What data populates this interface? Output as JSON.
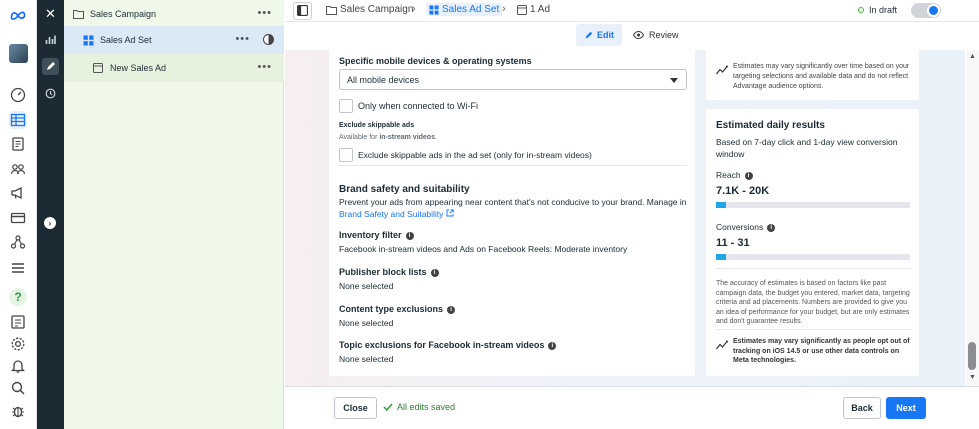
{
  "rail": {
    "icons": [
      "meta-logo-icon",
      "avatar",
      "dashboard-icon",
      "campaigns-table-icon",
      "pages-icon",
      "audiences-icon",
      "megaphone-icon",
      "billing-icon",
      "events-icon",
      "menu-icon",
      "help-icon",
      "reports-icon",
      "settings-icon",
      "notifications-icon",
      "search-icon",
      "bug-icon"
    ]
  },
  "tree": {
    "campaign_label": "Sales Campaign",
    "adset_label": "Sales Ad Set",
    "ad_label": "New Sales Ad"
  },
  "topbar": {
    "crumb_campaign": "Sales Campaign",
    "crumb_adset": "Sales Ad Set",
    "crumb_ad": "1 Ad",
    "status": "In draft",
    "edit_label": "Edit",
    "review_label": "Review"
  },
  "main": {
    "devices_heading": "Specific mobile devices & operating systems",
    "devices_value": "All mobile devices",
    "wifi_label": "Only when connected to Wi-Fi",
    "exclude_heading": "Exclude skippable ads",
    "exclude_sub_prefix": "Available for ",
    "exclude_sub_bold": "in-stream videos",
    "exclude_sub_suffix": ".",
    "exclude_label": "Exclude skippable ads in the ad set (only for in-stream videos)",
    "brand_heading": "Brand safety and suitability",
    "brand_desc": "Prevent your ads from appearing near content that's not conducive to your brand. Manage in",
    "brand_link": "Brand Safety and Suitability",
    "inventory_heading": "Inventory filter",
    "inventory_value": "Facebook in-stream videos and Ads on Facebook Reels: Moderate inventory",
    "publisher_heading": "Publisher block lists",
    "publisher_value": "None selected",
    "content_heading": "Content type exclusions",
    "content_value": "None selected",
    "topic_heading": "Topic exclusions for Facebook in-stream videos",
    "topic_value": "None selected"
  },
  "side": {
    "top_note": "Estimates may vary significantly over time based on your targeting selections and available data and do not reflect Advantage audience options.",
    "title": "Estimated daily results",
    "subtitle": "Based on 7-day click and 1-day view conversion window",
    "reach_label": "Reach",
    "reach_value": "7.1K - 20K",
    "reach_fill": 0.05,
    "conv_label": "Conversions",
    "conv_value": "11 - 31",
    "conv_fill": 0.05,
    "accuracy_note": "The accuracy of estimates is based on factors like past campaign data, the budget you entered, market data, targeting criteria and ad placements. Numbers are provided to give you an idea of performance for your budget, but are only estimates and don't guarantee results.",
    "ios_note": "Estimates may vary significantly as people opt out of tracking on iOS 14.5 or use other data controls on Meta technologies."
  },
  "footer": {
    "close_label": "Close",
    "saved_label": "All edits saved",
    "back_label": "Back",
    "next_label": "Next"
  },
  "colors": {
    "accent": "#1877f2",
    "draft_dot": "#42b72a",
    "sidebar_dark": "#1c2b33",
    "tree_bg": "#f0f8ea"
  }
}
